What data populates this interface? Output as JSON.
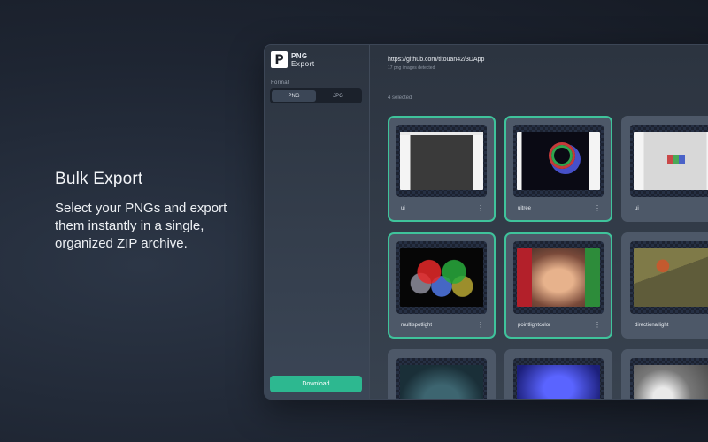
{
  "promo": {
    "title": "Bulk Export",
    "text": "Select your PNGs and export them instantly in a single, organized ZIP archive."
  },
  "app": {
    "logo": {
      "mark": "P",
      "line1": "PNG",
      "line2": "Export"
    },
    "format": {
      "label": "Format",
      "options": [
        "PNG",
        "JPG"
      ],
      "selected": "PNG"
    },
    "download_label": "Download",
    "repo_url": "https://github.com/titouan42/3DApp",
    "detected_text": "17 png images detected",
    "selected_text": "4 selected",
    "images": [
      {
        "label": "ui",
        "selected": true
      },
      {
        "label": "uitree",
        "selected": true
      },
      {
        "label": "ui",
        "selected": false
      },
      {
        "label": "multispotlight",
        "selected": true
      },
      {
        "label": "pointlightcolor",
        "selected": true
      },
      {
        "label": "directionallight",
        "selected": false
      },
      {
        "label": "",
        "selected": false
      },
      {
        "label": "",
        "selected": false
      },
      {
        "label": "",
        "selected": false
      }
    ],
    "colors": {
      "accent": "#3fc39b",
      "download": "#2db890"
    },
    "icons": {
      "card_menu": "more-vertical-icon"
    }
  }
}
